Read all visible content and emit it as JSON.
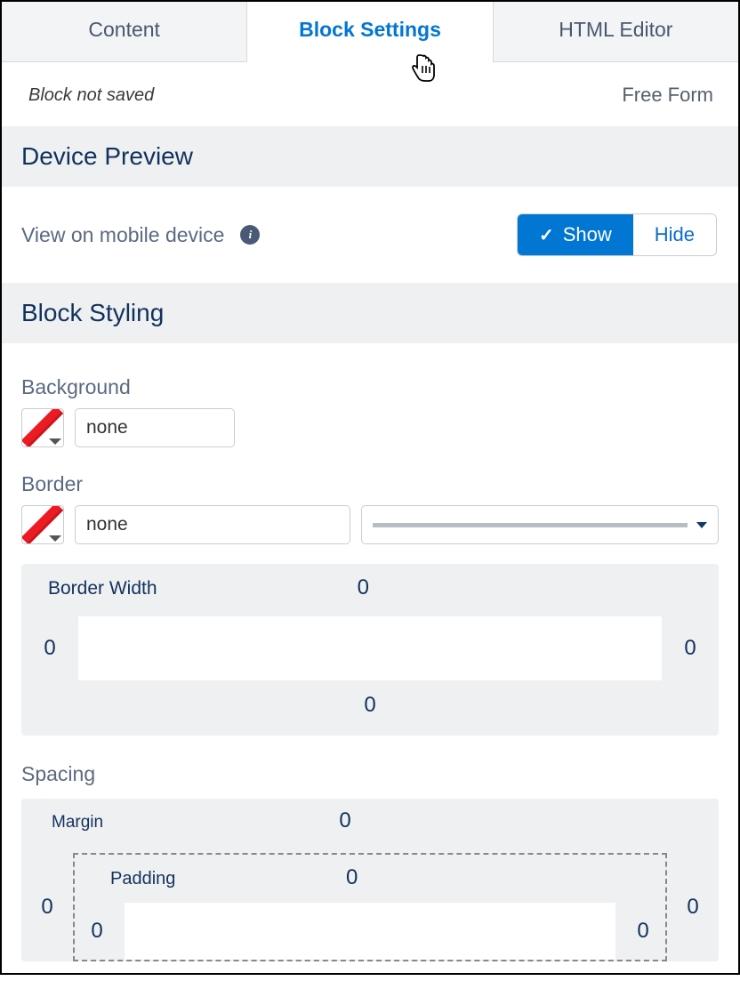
{
  "tabs": {
    "content": "Content",
    "block_settings": "Block Settings",
    "html_editor": "HTML Editor"
  },
  "status": {
    "not_saved": "Block not saved",
    "free_form": "Free Form"
  },
  "sections": {
    "device_preview_title": "Device Preview",
    "block_styling_title": "Block Styling"
  },
  "device_preview": {
    "label": "View on mobile device",
    "show": "Show",
    "hide": "Hide"
  },
  "styling": {
    "background": {
      "label": "Background",
      "value": "none"
    },
    "border": {
      "label": "Border",
      "value": "none"
    },
    "border_width": {
      "label": "Border Width",
      "top": "0",
      "left": "0",
      "right": "0",
      "bottom": "0"
    },
    "spacing": {
      "label": "Spacing",
      "margin_label": "Margin",
      "padding_label": "Padding",
      "margin_top": "0",
      "margin_left": "0",
      "margin_right": "0",
      "padding_top": "0",
      "padding_left": "0",
      "padding_right": "0"
    }
  }
}
